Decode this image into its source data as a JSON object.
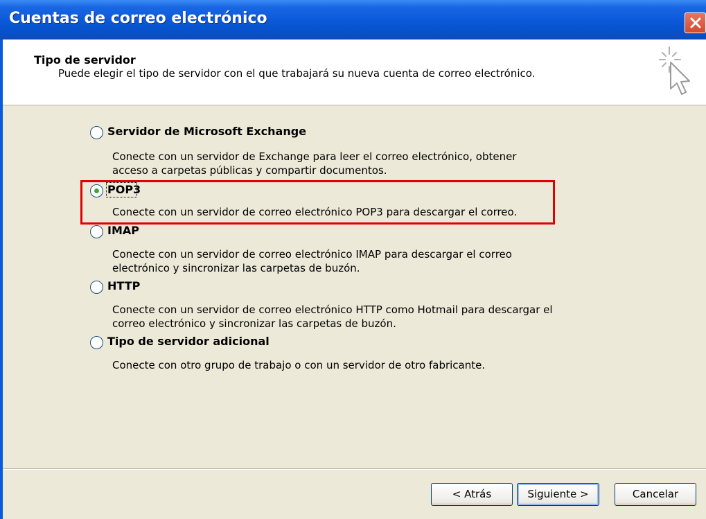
{
  "window": {
    "title": "Cuentas de correo electrónico"
  },
  "header": {
    "title": "Tipo de servidor",
    "subtitle": "Puede elegir el tipo de servidor con el que trabajará su nueva cuenta de correo electrónico."
  },
  "options": [
    {
      "label": "Servidor de Microsoft Exchange",
      "description": "Conecte con un servidor de Exchange para leer el correo electrónico, obtener acceso a carpetas públicas y compartir documentos.",
      "selected": false
    },
    {
      "label": "POP3",
      "description": "Conecte con un servidor de correo electrónico POP3 para descargar el correo.",
      "selected": true
    },
    {
      "label": "IMAP",
      "description": "Conecte con un servidor de correo electrónico IMAP para descargar el correo electrónico y sincronizar las carpetas de buzón.",
      "selected": false
    },
    {
      "label": "HTTP",
      "description": "Conecte con un servidor de correo electrónico HTTP como Hotmail para descargar el correo electrónico y sincronizar las carpetas de buzón.",
      "selected": false
    },
    {
      "label": "Tipo de servidor adicional",
      "description": "Conecte con otro grupo de trabajo o con un servidor de otro fabricante.",
      "selected": false
    }
  ],
  "buttons": {
    "back": "< Atrás",
    "next": "Siguiente >",
    "cancel": "Cancelar"
  },
  "colors": {
    "titlebar": "#0A58D8",
    "highlight": "#E00000",
    "face": "#ECE9D8",
    "radio_checked": "#3FA63F"
  },
  "icons": {
    "close": "close-icon",
    "wizard": "wizard-cursor-icon"
  }
}
